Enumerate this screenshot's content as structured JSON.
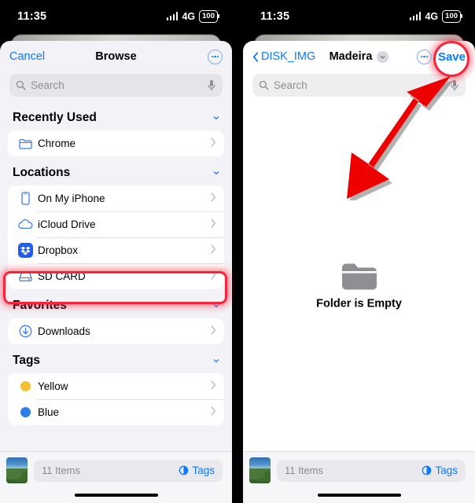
{
  "status_bar": {
    "time": "11:35",
    "network": "4G",
    "battery": "100"
  },
  "left_panel": {
    "nav": {
      "cancel_label": "Cancel",
      "title": "Browse",
      "more_label": "more-options"
    },
    "search": {
      "placeholder": "Search"
    },
    "sections": [
      {
        "title": "Recently Used",
        "rows": [
          {
            "label": "Chrome",
            "icon": "folder-icon"
          }
        ]
      },
      {
        "title": "Locations",
        "rows": [
          {
            "label": "On My iPhone",
            "icon": "iphone-icon"
          },
          {
            "label": "iCloud Drive",
            "icon": "cloud-icon"
          },
          {
            "label": "Dropbox",
            "icon": "dropbox-icon"
          },
          {
            "label": "SD CARD",
            "icon": "drive-icon"
          }
        ]
      },
      {
        "title": "Favorites",
        "rows": [
          {
            "label": "Downloads",
            "icon": "download-circle-icon"
          }
        ]
      },
      {
        "title": "Tags",
        "rows": [
          {
            "label": "Yellow",
            "icon": "yellow-dot-icon",
            "color": "#f5c033"
          },
          {
            "label": "Blue",
            "icon": "blue-dot-icon",
            "color": "#2f7ded"
          }
        ]
      }
    ],
    "bottom_bar": {
      "items_text": "11 Items",
      "tags_label": "Tags"
    }
  },
  "right_panel": {
    "nav": {
      "back_label": "DISK_IMG",
      "title": "Madeira",
      "more_label": "more-options",
      "save_label": "Save"
    },
    "search": {
      "placeholder": "Search"
    },
    "empty_state": {
      "label": "Folder is Empty",
      "icon": "folder-icon"
    },
    "bottom_bar": {
      "items_text": "11 Items",
      "tags_label": "Tags"
    }
  },
  "annotations": {
    "highlight_color": "#f8253a",
    "arrow_color": "#ee0000",
    "highlighted_row": "SD CARD",
    "highlighted_button": "Save"
  },
  "colors": {
    "accent": "#0a7aff",
    "sheet_bg": "#f2f2f7",
    "row_bg": "#ffffff"
  }
}
